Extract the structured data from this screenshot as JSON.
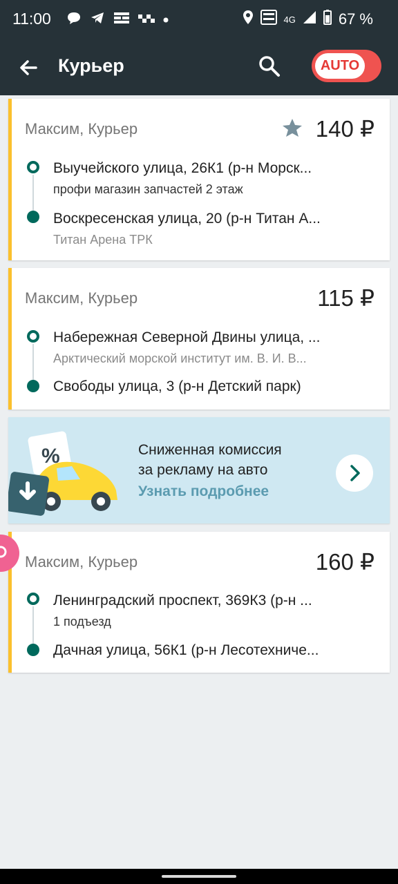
{
  "status_bar": {
    "time": "11:00",
    "network": "4G",
    "battery": "67 %"
  },
  "app_bar": {
    "title": "Курьер",
    "auto_toggle_label": "AUTO"
  },
  "orders": [
    {
      "customer": "Максим, Курьер",
      "price": "140 ₽",
      "starred": true,
      "from_address": "Выучейского улица, 26К1 (р-н Морск...",
      "from_note": "профи магазин запчастей 2 этаж",
      "to_address": "Воскресенская улица, 20 (р-н Титан А...",
      "to_note": "Титан Арена ТРК"
    },
    {
      "customer": "Максим, Курьер",
      "price": "115 ₽",
      "starred": false,
      "from_address": "Набережная Северной Двины улица, ...",
      "from_note": "Арктический морской институт им. В. И. В...",
      "to_address": "Свободы улица, 3 (р-н Детский парк)"
    },
    {
      "customer": "Максим, Курьер",
      "price": "160 ₽",
      "starred": false,
      "from_address": "Ленинградский проспект, 369К3 (р-н ...",
      "from_note": "1 подъезд",
      "to_address": "Дачная улица, 56К1 (р-н Лесотехниче..."
    }
  ],
  "promo": {
    "line1": "Сниженная комиссия",
    "line2": "за рекламу на авто",
    "link": "Узнать подробнее",
    "art_badge_text": "%"
  },
  "colors": {
    "app_bar": "#263238",
    "accent_card_border": "#fbc02d",
    "route_teal": "#00695c",
    "auto_toggle": "#ef5350",
    "promo_bg": "#cfe8f2"
  }
}
